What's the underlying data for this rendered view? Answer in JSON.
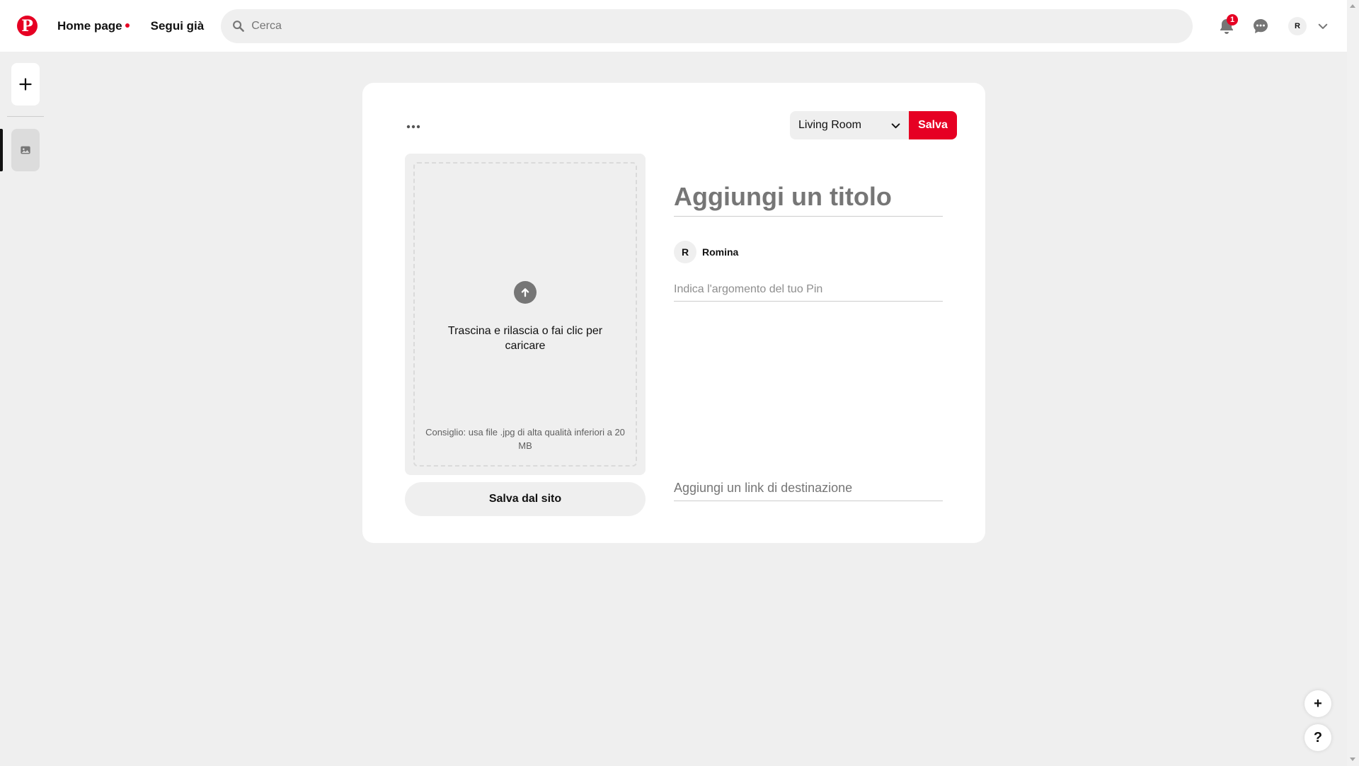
{
  "header": {
    "logo_icon": "pinterest-logo-icon",
    "logo_glyph": "P",
    "nav": [
      {
        "label": "Home page",
        "has_dot": true
      },
      {
        "label": "Segui già"
      }
    ],
    "search": {
      "placeholder": "Cerca",
      "icon": "search-icon"
    },
    "notifications": {
      "icon": "bell-icon",
      "count": "1"
    },
    "messages": {
      "icon": "chat-bubble-icon"
    },
    "profile": {
      "initial": "R",
      "icon": "chevron-down-icon"
    }
  },
  "rail": {
    "add_icon": "plus-icon",
    "draft_icon": "image-icon"
  },
  "editor": {
    "more_icon": "ellipsis-icon",
    "board": {
      "selected": "Living Room",
      "icon": "chevron-down-icon"
    },
    "save_label": "Salva",
    "upload": {
      "icon": "arrow-up-circle-icon",
      "text": "Trascina e rilascia o fai clic per caricare",
      "tip": "Consiglio: usa file .jpg di alta qualità inferiori a 20 MB"
    },
    "save_from_site_label": "Salva dal sito",
    "title": {
      "placeholder": "Aggiungi un titolo",
      "value": ""
    },
    "author": {
      "initial": "R",
      "name": "Romina"
    },
    "description": {
      "placeholder": "Indica l'argomento del tuo Pin",
      "value": ""
    },
    "link": {
      "placeholder": "Aggiungi un link di destinazione",
      "value": ""
    }
  },
  "floating": {
    "add_label": "+",
    "help_label": "?"
  },
  "colors": {
    "brand_red": "#e60023",
    "background": "#efefef",
    "card": "#ffffff",
    "placeholder_gray": "#767676"
  }
}
